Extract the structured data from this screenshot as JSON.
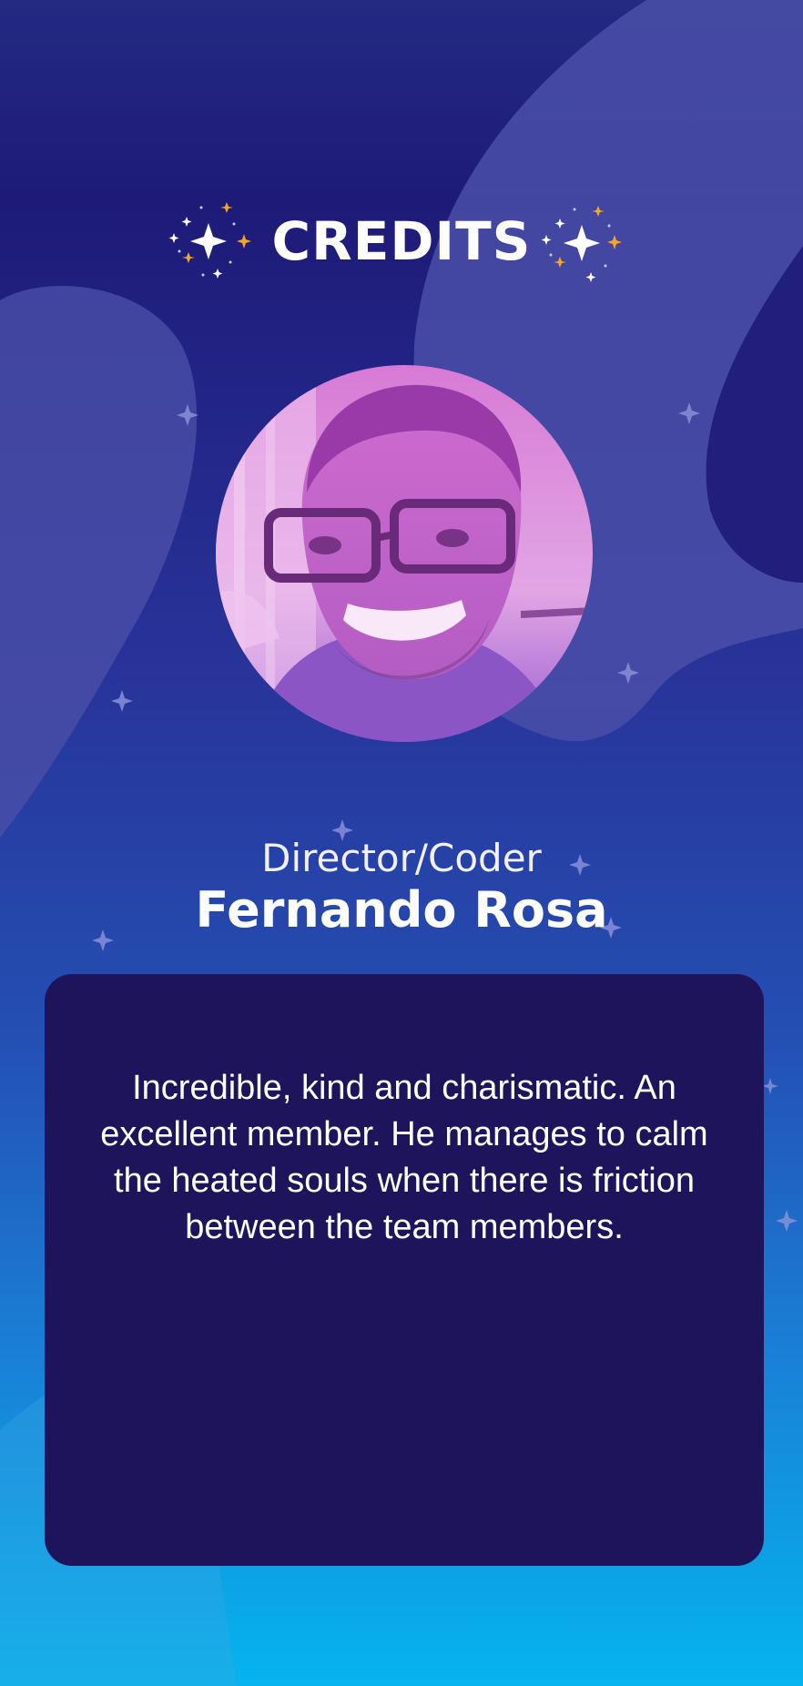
{
  "screen": {
    "title": "CREDITS"
  },
  "member": {
    "role": "Director/Coder",
    "name": "Fernando Rosa",
    "bio": "Incredible, kind and charismatic. An excellent member. He manages to calm the heated souls when there is friction between the team members.",
    "photo_icon": "portrait-photo"
  },
  "colors": {
    "background_top": "#1e1a78",
    "background_bottom": "#05b4ee",
    "card": "#1e145c",
    "accent_star": "#f5a623",
    "photo_tint": "#c84fc8"
  }
}
